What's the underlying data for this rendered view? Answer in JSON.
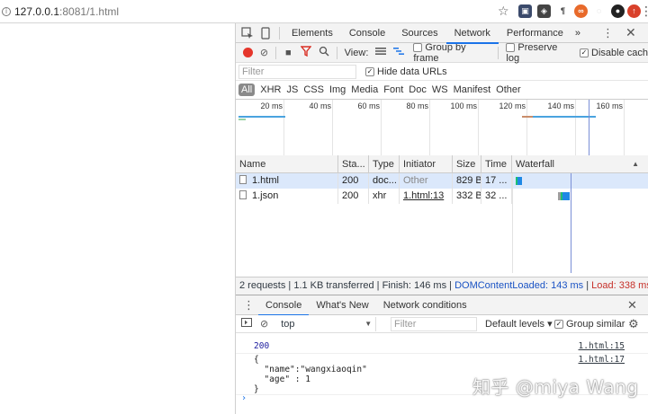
{
  "address_bar": {
    "host": "127.0.0.1",
    "path": ":8081/1.html"
  },
  "extensions": [
    "extension-icon-1",
    "extension-icon-2",
    "extension-icon-3",
    "extension-icon-4",
    "extension-icon-5",
    "github-icon",
    "extension-icon-7"
  ],
  "devtools": {
    "tabs": [
      "Elements",
      "Console",
      "Sources",
      "Network",
      "Performance"
    ],
    "active_tab": "Network",
    "more_tabs": "»",
    "toolbar": {
      "view_label": "View:",
      "group_by_frame": "Group by frame",
      "preserve_log": "Preserve log",
      "disable_cache": "Disable cach"
    },
    "filter": {
      "placeholder": "Filter",
      "hide_data_urls": "Hide data URLs"
    },
    "types": [
      "All",
      "XHR",
      "JS",
      "CSS",
      "Img",
      "Media",
      "Font",
      "Doc",
      "WS",
      "Manifest",
      "Other"
    ],
    "overview_ticks": [
      "20 ms",
      "40 ms",
      "60 ms",
      "80 ms",
      "100 ms",
      "120 ms",
      "140 ms",
      "160 ms"
    ],
    "columns": [
      "Name",
      "Sta...",
      "Type",
      "Initiator",
      "Size",
      "Time",
      "Waterfall"
    ],
    "rows": [
      {
        "name": "1.html",
        "status": "200",
        "type": "doc...",
        "initiator": "Other",
        "size": "829 B",
        "time": "17 ..."
      },
      {
        "name": "1.json",
        "status": "200",
        "type": "xhr",
        "initiator": "1.html:13",
        "size": "332 B",
        "time": "32 ..."
      }
    ],
    "status": {
      "summary": "2 requests | 1.1 KB transferred | Finish: 146 ms | ",
      "dom": "DOMContentLoaded: 143 ms",
      "divider": " | ",
      "load": "Load: 338 ms"
    },
    "drawer": {
      "tabs": [
        "Console",
        "What's New",
        "Network conditions"
      ],
      "context": "top",
      "filter_placeholder": "Filter",
      "levels": "Default levels ▾",
      "group_similar": "Group similar",
      "messages": [
        {
          "text": "200",
          "source": "1.html:15"
        },
        {
          "text": "{\n  \"name\":\"wangxiaoqin\"\n  \"age\" : 1\n}",
          "source": "1.html:17"
        }
      ],
      "prompt": "›"
    }
  },
  "watermark": "知乎 @miya Wang",
  "colors": {
    "accent": "#1a73e8",
    "record": "#e5362b",
    "dom_blue": "#1a53c4",
    "load_red": "#c6302a"
  }
}
